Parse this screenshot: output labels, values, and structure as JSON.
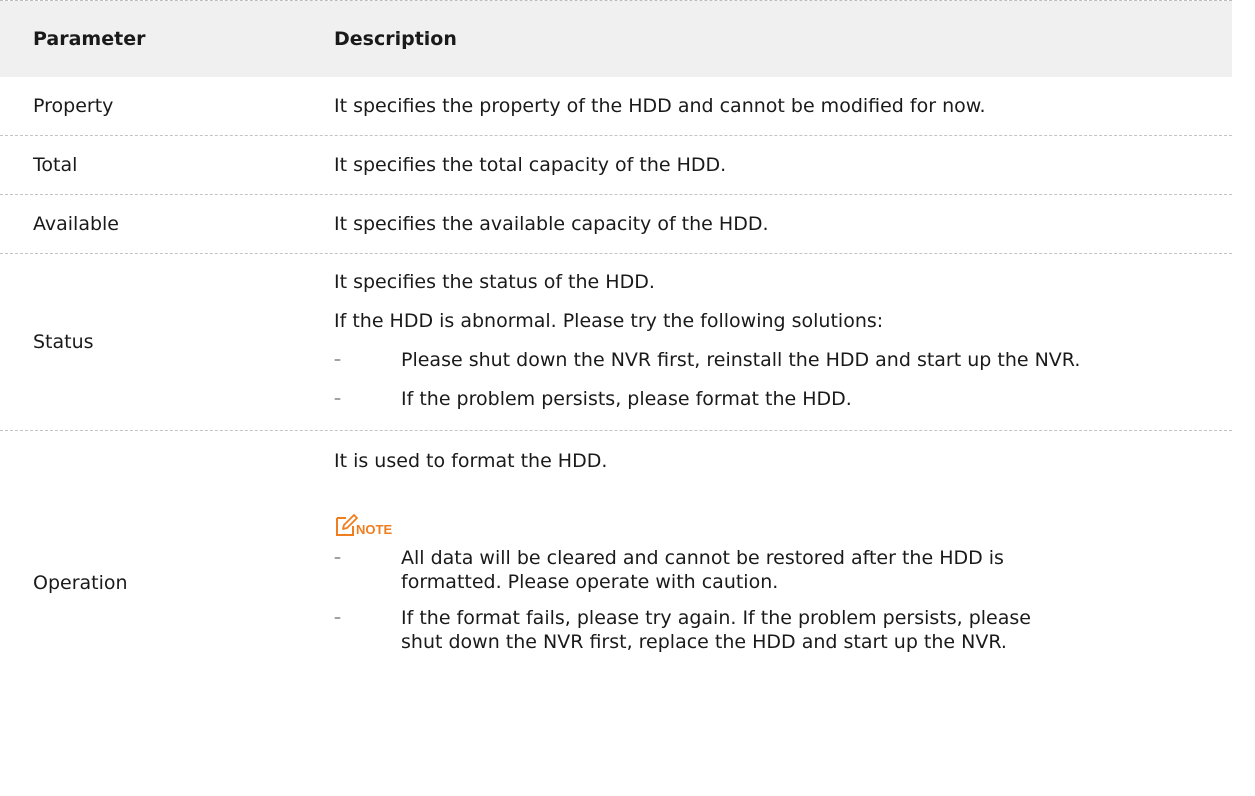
{
  "table": {
    "header": {
      "parameter": "Parameter",
      "description": "Description"
    },
    "rows": [
      {
        "parameter": "Property",
        "description": "It specifies the property of the HDD and cannot be modified for now."
      },
      {
        "parameter": "Total",
        "description": "It specifies the total capacity of the HDD."
      },
      {
        "parameter": "Available",
        "description": "It specifies the available capacity of the HDD."
      }
    ],
    "status": {
      "parameter": "Status",
      "paragraphs": [
        "It specifies the status of the HDD.",
        "If the HDD is abnormal. Please try the following solutions:"
      ],
      "items": [
        "Please shut down the NVR first, reinstall the HDD and start up the NVR.",
        "If the problem persists, please format the HDD."
      ]
    },
    "operation": {
      "parameter": "Operation",
      "paragraph": "It is used to format the HDD.",
      "note_label": "NOTE",
      "items": [
        "All data will be cleared and cannot be restored after the HDD is formatted. Please operate with caution.",
        "If the format fails, please try again. If the problem persists, please shut down the NVR first, replace the HDD and start up the NVR."
      ]
    },
    "bullet_glyph": "–",
    "note_icon": "note-pencil-icon",
    "colors": {
      "header_bg": "#f0f0f0",
      "note_accent": "#f07e1e",
      "divider": "#c4c4c4"
    }
  }
}
